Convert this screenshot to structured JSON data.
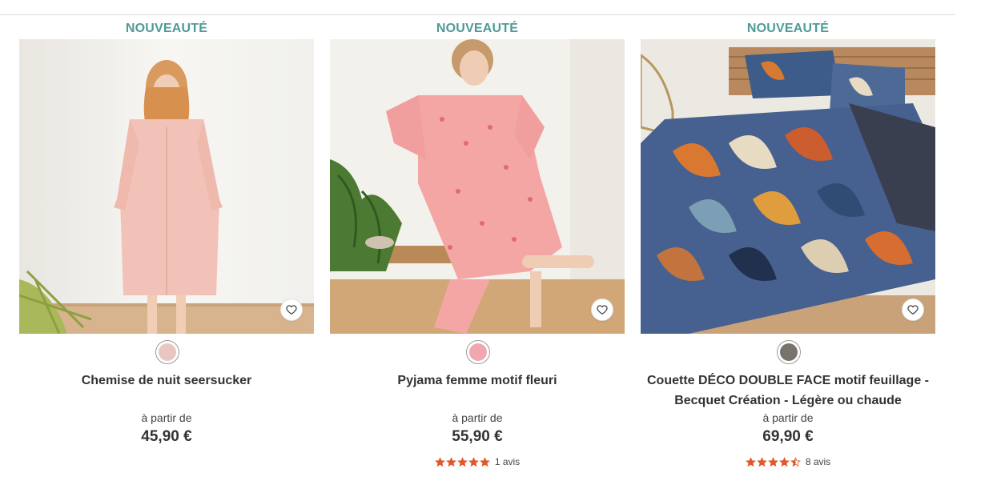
{
  "products": [
    {
      "badge": "NOUVEAUTÉ",
      "name": "Chemise de nuit seersucker",
      "price_prefix": "à partir de",
      "price": "45,90 €",
      "swatch_color": "#e8c7c3",
      "rating": null,
      "reviews": null
    },
    {
      "badge": "NOUVEAUTÉ",
      "name": "Pyjama femme motif fleuri",
      "price_prefix": "à partir de",
      "price": "55,90 €",
      "swatch_color": "#f0a7b0",
      "rating": 5,
      "reviews": "1 avis"
    },
    {
      "badge": "NOUVEAUTÉ",
      "name": "Couette DÉCO DOUBLE FACE motif feuillage - Becquet Création - Légère ou chaude",
      "price_prefix": "à partir de",
      "price": "69,90 €",
      "swatch_color": "#7a736c",
      "rating": 4.5,
      "reviews": "8 avis"
    }
  ],
  "icons": {
    "favorite": "heart-outline-icon",
    "star": "star-icon"
  },
  "colors": {
    "badge": "#4f9a97",
    "star": "#e0582a"
  }
}
